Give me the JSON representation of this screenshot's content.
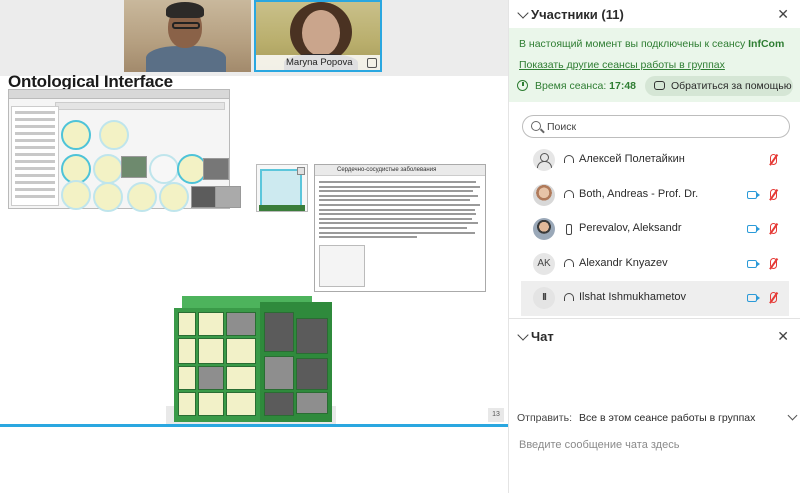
{
  "video": {
    "participant_2_name": "Maryna Popova"
  },
  "slide": {
    "title": "Ontological Interface",
    "page_number": "13",
    "doc_heading": "Сердечно-сосудистые заболевания"
  },
  "participants": {
    "title": "Участники (11)",
    "connected_prefix": "В настоящий момент вы подключены к сеансу",
    "session_name": "InfCom",
    "show_other_sessions": "Показать другие сеансы работы в группах",
    "session_time_label": "Время сеанса:",
    "session_time_value": "17:48",
    "help_button": "Обратиться за помощью",
    "search_placeholder": "Поиск",
    "list": [
      {
        "name": "Алексей Полетайкин",
        "avatar": "person-icon",
        "device": "headset",
        "camera": false,
        "mic_muted": true
      },
      {
        "name": "Both, Andreas - Prof. Dr.",
        "avatar": "photo",
        "device": "headset",
        "camera": true,
        "mic_muted": true
      },
      {
        "name": "Perevalov, Aleksandr",
        "avatar": "photo",
        "device": "phone",
        "camera": true,
        "mic_muted": true
      },
      {
        "name": "Alexandr Knyazev",
        "avatar": "AK",
        "device": "headset",
        "camera": true,
        "mic_muted": true
      },
      {
        "name": "Ilshat Ishmukhametov",
        "avatar": "II",
        "device": "headset",
        "camera": true,
        "mic_muted": true
      }
    ]
  },
  "chat": {
    "title": "Чат",
    "send_label": "Отправить:",
    "send_target": "Все в этом сеансе работы в группах",
    "input_placeholder": "Введите сообщение чата здесь"
  },
  "colors": {
    "accent_blue": "#2aa7e0",
    "session_green": "#2e7d32",
    "muted_red": "#e53935"
  }
}
